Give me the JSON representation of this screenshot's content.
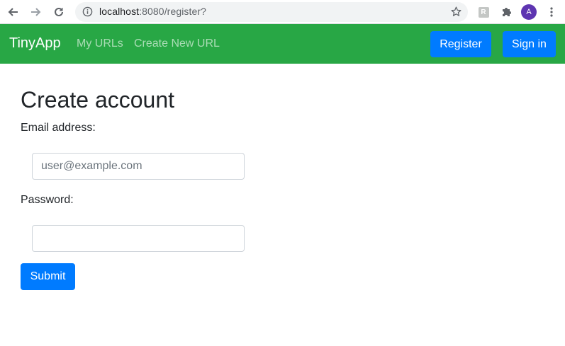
{
  "browser": {
    "url_host": "localhost",
    "url_path": ":8080/register?",
    "profile_initial": "A",
    "extension_letter": "R"
  },
  "navbar": {
    "brand": "TinyApp",
    "links": [
      {
        "label": "My URLs"
      },
      {
        "label": "Create New URL"
      }
    ],
    "register_label": "Register",
    "signin_label": "Sign in",
    "background": "#28a745",
    "button_color": "#007bff"
  },
  "form": {
    "title": "Create account",
    "email_label": "Email address:",
    "email_placeholder": "user@example.com",
    "password_label": "Password:",
    "submit_label": "Submit"
  }
}
